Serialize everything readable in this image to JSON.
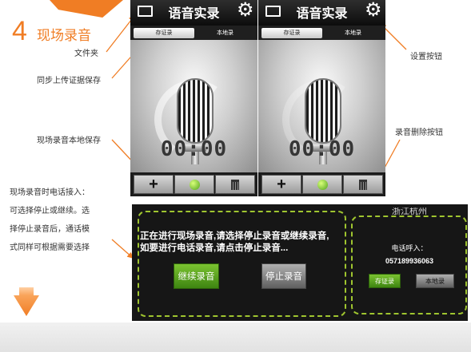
{
  "section": {
    "step_number": "4",
    "title": "现场录音"
  },
  "callouts": {
    "folder": "文件夹",
    "upload_save": "同步上传证据保存",
    "local_save": "现场录音本地保存",
    "settings": "设置按钮",
    "delete": "录音删除按钮"
  },
  "note_lines": [
    "现场录音时电话接入：",
    "可选择停止或继续。选",
    "择停止录音后，通话模",
    "式同样可根据需要选择"
  ],
  "app": {
    "title": "语音实录",
    "tabs": [
      "存证录",
      "本地录"
    ],
    "timer": "00:00",
    "icons": [
      "folder-icon",
      "gear-icon",
      "plus-icon",
      "record-icon",
      "trash-icon",
      "microphone-icon"
    ]
  },
  "dialog": {
    "message_lines": [
      "正在进行现场录音,请选择停止录音或继续录音,",
      "如要进行电话录音,请点击停止录音..."
    ],
    "continue_button": "继续录音",
    "stop_button": "停止录音"
  },
  "call": {
    "top_text": "浙江杭州",
    "label": "电话呼入：",
    "number": "057189936063",
    "save_button": "存证录",
    "local_button": "本地录"
  },
  "colors": {
    "accent": "#f07d24",
    "dialog_border": "#9fc52f",
    "button_green": "#5ba620"
  }
}
